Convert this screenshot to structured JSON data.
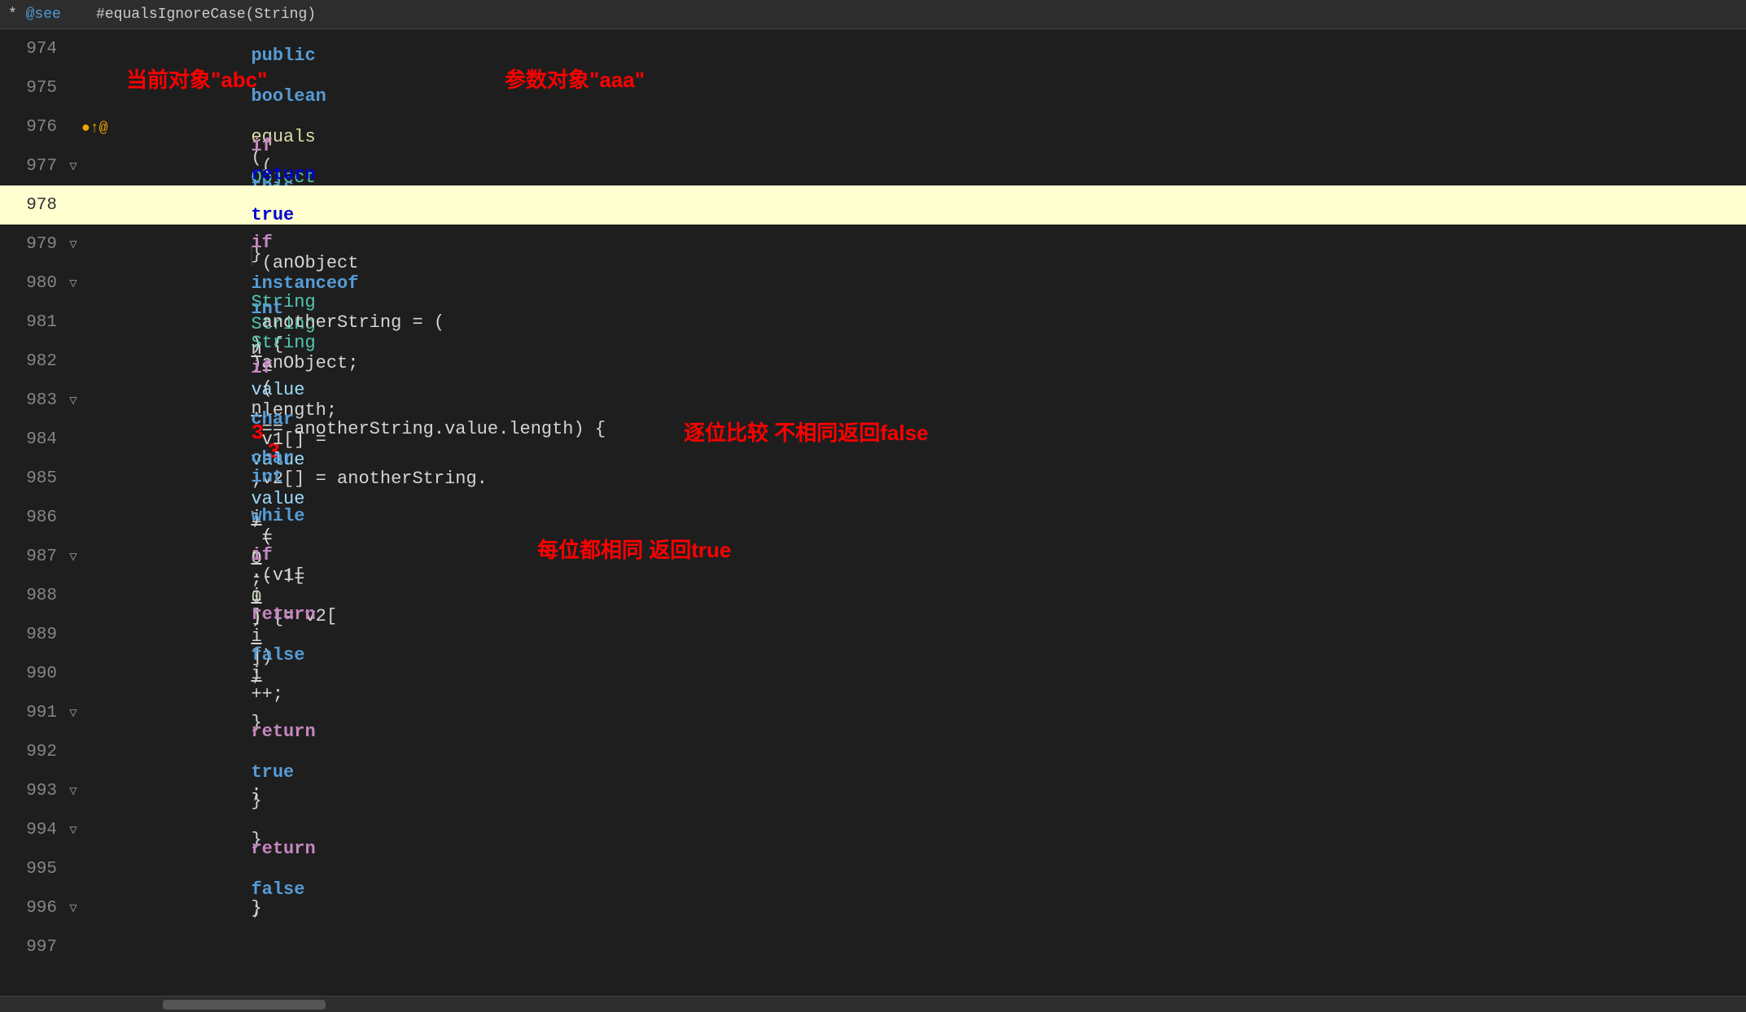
{
  "topbar": {
    "text": "* @see   #equalsIgnoreCase(String)"
  },
  "annotations": {
    "current_obj": "当前对象\"abc\"",
    "param_obj": "参数对象\"aaa\"",
    "char_compare": "逐位比较 不相同返回false",
    "all_same": "每位都相同 返回true"
  },
  "lines": [
    {
      "num": "974",
      "fold": false,
      "gutter": "",
      "code": ""
    },
    {
      "num": "975",
      "fold": false,
      "gutter": "",
      "code": ""
    },
    {
      "num": "976",
      "fold": false,
      "gutter": "●↑@",
      "code": "    public boolean equals(Object anObject) {"
    },
    {
      "num": "977",
      "fold": false,
      "gutter": "▽",
      "code": "        if (this == anObject) {"
    },
    {
      "num": "978",
      "fold": false,
      "gutter": "",
      "code": "            return true;",
      "active": true
    },
    {
      "num": "979",
      "fold": false,
      "gutter": "▽",
      "code": "        }"
    },
    {
      "num": "980",
      "fold": false,
      "gutter": "▽",
      "code": "        if (anObject instanceof String) {"
    },
    {
      "num": "981",
      "fold": false,
      "gutter": "",
      "code": "            String anotherString = (String)anObject;"
    },
    {
      "num": "982",
      "fold": false,
      "gutter": "",
      "code": "            int n = value.length;",
      "rednum": "3"
    },
    {
      "num": "983",
      "fold": false,
      "gutter": "▽",
      "code": "            if (n == anotherString.value.length) {",
      "rednum2": "3"
    },
    {
      "num": "984",
      "fold": false,
      "gutter": "",
      "code": "                char v1[] = value;"
    },
    {
      "num": "985",
      "fold": false,
      "gutter": "",
      "code": "                char v2[] = anotherString.value;"
    },
    {
      "num": "986",
      "fold": false,
      "gutter": "",
      "code": "                int i = 0;"
    },
    {
      "num": "987",
      "fold": false,
      "gutter": "▽",
      "code": "                while (n-- != 0) {"
    },
    {
      "num": "988",
      "fold": false,
      "gutter": "",
      "code": "                    if (v1[i] != v2[i])"
    },
    {
      "num": "989",
      "fold": false,
      "gutter": "",
      "code": "                        return false;"
    },
    {
      "num": "990",
      "fold": false,
      "gutter": "",
      "code": "                    i++;"
    },
    {
      "num": "991",
      "fold": false,
      "gutter": "▽",
      "code": "                }"
    },
    {
      "num": "992",
      "fold": false,
      "gutter": "",
      "code": "                return true;"
    },
    {
      "num": "993",
      "fold": false,
      "gutter": "▽",
      "code": "            }"
    },
    {
      "num": "994",
      "fold": false,
      "gutter": "▽",
      "code": "        }"
    },
    {
      "num": "995",
      "fold": false,
      "gutter": "",
      "code": "        return false;"
    },
    {
      "num": "996",
      "fold": false,
      "gutter": "▽",
      "code": "    }"
    },
    {
      "num": "997",
      "fold": false,
      "gutter": "",
      "code": ""
    }
  ]
}
